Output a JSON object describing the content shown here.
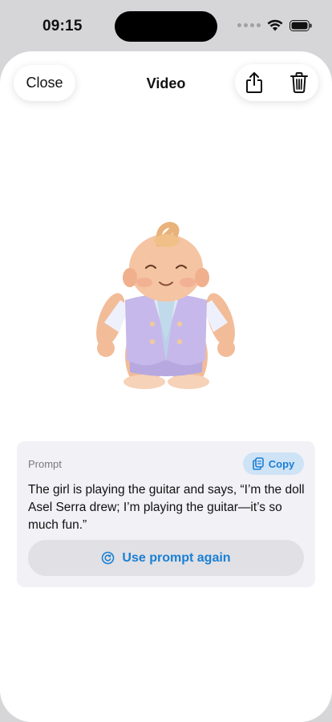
{
  "status_bar": {
    "time": "09:15"
  },
  "header": {
    "close_label": "Close",
    "title": "Video"
  },
  "media": {
    "description_icon": "baby-doll-image"
  },
  "prompt": {
    "label": "Prompt",
    "copy_label": "Copy",
    "text": "The girl is playing the guitar and says, “I’m the doll Asel Serra drew; I’m playing the guitar—it’s so much fun.”",
    "reuse_label": "Use prompt again"
  },
  "colors": {
    "accent": "#1a7fd4",
    "copy_bg": "#cfe3f6",
    "card_bg": "#f1f1f6"
  }
}
